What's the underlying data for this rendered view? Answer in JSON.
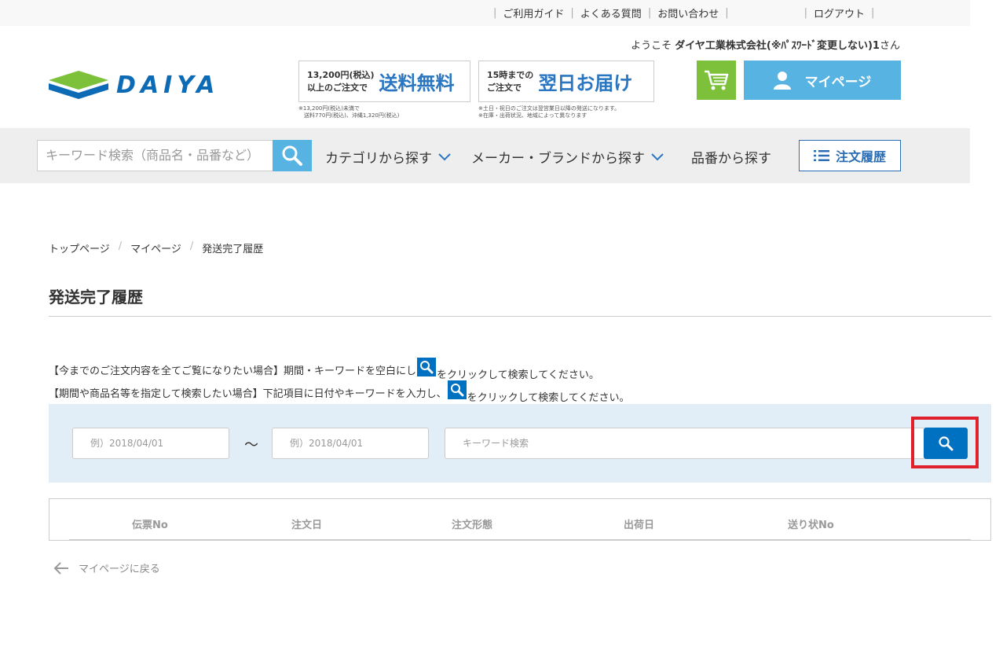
{
  "topbar": {
    "links": [
      "ご利用ガイド",
      "よくある質問",
      "お問い合わせ"
    ],
    "logout": "ログアウト"
  },
  "welcome": {
    "prefix": "ようこそ ",
    "company": "ダイヤ工業株式会社(※ﾊﾟｽﾜｰﾄﾞ変更しない)1",
    "suffix": "さん"
  },
  "logo": {
    "wordmark": "DAIYA"
  },
  "banners": {
    "shipping": {
      "small1": "13,200円(税込)",
      "small2": "以上のご注文で",
      "big": "送料無料",
      "note1": "※13,200円(税込)未満で",
      "note2": "　送料770円(税込)、沖縄1,320円(税込)"
    },
    "delivery": {
      "small1": "15時までの",
      "small2": "ご注文で",
      "big": "翌日お届け",
      "note1": "※土日・祝日のご注文は翌営業日以降の発送になります。",
      "note2": "※在庫・出荷状況、地域によって異なります"
    }
  },
  "header": {
    "mypage_label": "マイページ"
  },
  "nav": {
    "search_placeholder": "キーワード検索（商品名・品番など）",
    "category": "カテゴリから探す",
    "maker": "メーカー・ブランドから探す",
    "partno": "品番から探す",
    "history": "注文履歴"
  },
  "breadcrumb": [
    "トップページ",
    "マイページ",
    "発送完了履歴"
  ],
  "page_title": "発送完了履歴",
  "instructions": {
    "line1_a": "【今までのご注文内容を全てご覧になりたい場合】期間・キーワードを空白にし",
    "line1_b": "をクリックして検索してください。",
    "line2_a": "【期間や商品名等を指定して検索したい場合】下記項目に日付やキーワードを入力し、",
    "line2_b": "をクリックして検索してください。"
  },
  "search": {
    "date_from_placeholder": "例）2018/04/01",
    "tilde": "～",
    "date_to_placeholder": "例）2018/04/01",
    "keyword_placeholder": "キーワード検索"
  },
  "table": {
    "columns": [
      "伝票No",
      "注文日",
      "注文形態",
      "出荷日",
      "送り状No"
    ]
  },
  "back_link": "マイページに戻る",
  "colors": {
    "accent": "#56b3e2",
    "primary": "#0070c0",
    "cart": "#7dc13a",
    "highlight": "#e0202a"
  }
}
